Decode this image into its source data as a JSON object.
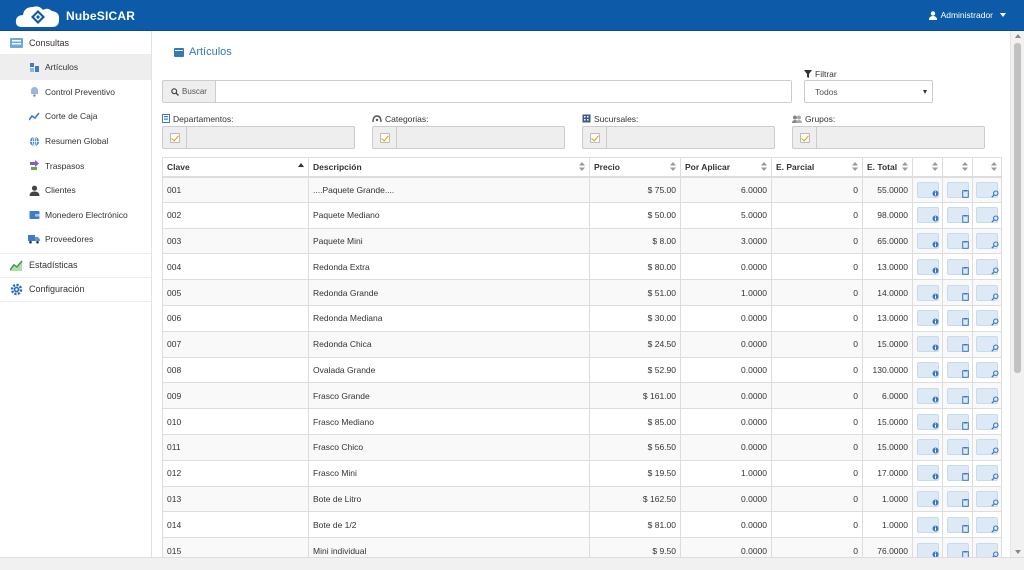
{
  "app": {
    "brand": "NubeSICAR",
    "user": "Administrador"
  },
  "sidebar": {
    "consultas": "Consultas",
    "items": [
      {
        "label": "Artículos",
        "icon": "boxes-icon",
        "active": true
      },
      {
        "label": "Control Preventivo",
        "icon": "bell-icon"
      },
      {
        "label": "Corte de Caja",
        "icon": "cash-icon"
      },
      {
        "label": "Resumen Global",
        "icon": "globe-icon"
      },
      {
        "label": "Traspasos",
        "icon": "transfer-icon"
      },
      {
        "label": "Clientes",
        "icon": "user-icon"
      },
      {
        "label": "Monedero Electrónico",
        "icon": "wallet-icon"
      },
      {
        "label": "Proveedores",
        "icon": "truck-icon"
      }
    ],
    "estadisticas": "Estadísticas",
    "configuracion": "Configuración"
  },
  "page": {
    "title": "Artículos"
  },
  "search": {
    "button": "Buscar",
    "value": ""
  },
  "filter": {
    "label": "Filtrar",
    "selected": "Todos"
  },
  "facets": {
    "departamentos": "Departamentos:",
    "categorias": "Categorias:",
    "sucursales": "Sucursales:",
    "grupos": "Grupos:"
  },
  "table": {
    "columns": [
      "Clave",
      "Descripción",
      "Precio",
      "Por Aplicar",
      "E. Parcial",
      "E. Total"
    ],
    "rows": [
      {
        "clave": "001",
        "desc": "....Paquete Grande....",
        "precio": "$ 75.00",
        "aplicar": "6.0000",
        "parcial": "0",
        "total": "55.0000"
      },
      {
        "clave": "002",
        "desc": "Paquete Mediano",
        "precio": "$ 50.00",
        "aplicar": "5.0000",
        "parcial": "0",
        "total": "98.0000"
      },
      {
        "clave": "003",
        "desc": "Paquete Mini",
        "precio": "$ 8.00",
        "aplicar": "3.0000",
        "parcial": "0",
        "total": "65.0000"
      },
      {
        "clave": "004",
        "desc": "Redonda Extra",
        "precio": "$ 80.00",
        "aplicar": "0.0000",
        "parcial": "0",
        "total": "13.0000"
      },
      {
        "clave": "005",
        "desc": "Redonda Grande",
        "precio": "$ 51.00",
        "aplicar": "1.0000",
        "parcial": "0",
        "total": "14.0000"
      },
      {
        "clave": "006",
        "desc": "Redonda Mediana",
        "precio": "$ 30.00",
        "aplicar": "0.0000",
        "parcial": "0",
        "total": "13.0000"
      },
      {
        "clave": "007",
        "desc": "Redonda Chica",
        "precio": "$ 24.50",
        "aplicar": "0.0000",
        "parcial": "0",
        "total": "15.0000"
      },
      {
        "clave": "008",
        "desc": "Ovalada Grande",
        "precio": "$ 52.90",
        "aplicar": "0.0000",
        "parcial": "0",
        "total": "130.0000"
      },
      {
        "clave": "009",
        "desc": "Frasco Grande",
        "precio": "$ 161.00",
        "aplicar": "0.0000",
        "parcial": "0",
        "total": "6.0000"
      },
      {
        "clave": "010",
        "desc": "Frasco Mediano",
        "precio": "$ 85.00",
        "aplicar": "0.0000",
        "parcial": "0",
        "total": "15.0000"
      },
      {
        "clave": "011",
        "desc": "Frasco Chico",
        "precio": "$ 56.50",
        "aplicar": "0.0000",
        "parcial": "0",
        "total": "15.0000"
      },
      {
        "clave": "012",
        "desc": "Frasco Mini",
        "precio": "$ 19.50",
        "aplicar": "1.0000",
        "parcial": "0",
        "total": "17.0000"
      },
      {
        "clave": "013",
        "desc": "Bote de Litro",
        "precio": "$ 162.50",
        "aplicar": "0.0000",
        "parcial": "0",
        "total": "1.0000"
      },
      {
        "clave": "014",
        "desc": "Bote de 1/2",
        "precio": "$ 81.00",
        "aplicar": "0.0000",
        "parcial": "0",
        "total": "1.0000"
      },
      {
        "clave": "015",
        "desc": "Mini individual",
        "precio": "$ 9.50",
        "aplicar": "0.0000",
        "parcial": "0",
        "total": "76.0000"
      }
    ]
  }
}
